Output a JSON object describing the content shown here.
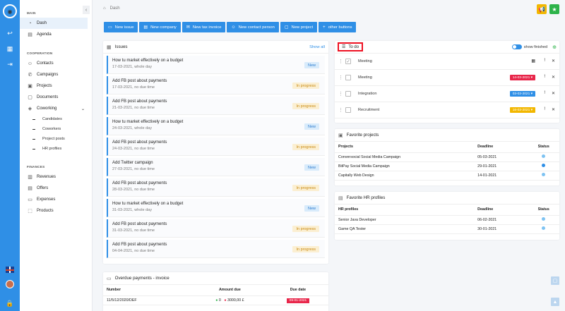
{
  "sidebar": {
    "main_title": "MAIN",
    "main": [
      {
        "label": "Dash",
        "icon": "dashboard-icon"
      },
      {
        "label": "Agenda",
        "icon": "calendar-icon"
      }
    ],
    "coop_title": "COOPERATION",
    "coop": [
      {
        "label": "Contacts",
        "icon": "contacts-icon"
      },
      {
        "label": "Campaigns",
        "icon": "campaigns-icon"
      },
      {
        "label": "Projects",
        "icon": "projects-icon"
      },
      {
        "label": "Documents",
        "icon": "documents-icon"
      },
      {
        "label": "Coworking",
        "icon": "coworking-icon"
      }
    ],
    "coworking_sub": [
      "Candidates",
      "Coworkers",
      "Project posts",
      "HR profiles"
    ],
    "fin_title": "FINANCES",
    "fin": [
      {
        "label": "Revenues",
        "icon": "revenues-icon"
      },
      {
        "label": "Offers",
        "icon": "offers-icon"
      },
      {
        "label": "Expenses",
        "icon": "expenses-icon"
      },
      {
        "label": "Products",
        "icon": "products-icon"
      }
    ]
  },
  "breadcrumb": "Dash",
  "actions": [
    {
      "label": "New issue",
      "icon": "issue-icon"
    },
    {
      "label": "New company",
      "icon": "company-icon"
    },
    {
      "label": "New tax invoice",
      "icon": "invoice-icon"
    },
    {
      "label": "New contact person",
      "icon": "contact-person-icon"
    },
    {
      "label": "New project",
      "icon": "project-icon"
    },
    {
      "label": "other buttons",
      "icon": "plus-icon"
    }
  ],
  "issues": {
    "title": "Issues",
    "show_all": "Show all",
    "items": [
      {
        "title": "How tu market effectively on a budget",
        "date": "17-03-2021, whole day",
        "status": "New"
      },
      {
        "title": "Add FB post about payments",
        "date": "17-03-2021, no due time",
        "status": "In progress"
      },
      {
        "title": "Add FB post about payments",
        "date": "21-03-2021, no due time",
        "status": "In progress"
      },
      {
        "title": "How tu market effectively on a budget",
        "date": "24-03-2021, whole day",
        "status": "New"
      },
      {
        "title": "Add FB post about payments",
        "date": "24-03-2021, no due time",
        "status": "In progress"
      },
      {
        "title": "Add Twitter campaign",
        "date": "27-03-2021, no due time",
        "status": "New"
      },
      {
        "title": "Add FB post about payments",
        "date": "28-03-2021, no due time",
        "status": "In progress"
      },
      {
        "title": "How tu market effectively on a budget",
        "date": "31-03-2021, whole day",
        "status": "New"
      },
      {
        "title": "Add FB post about payments",
        "date": "31-03-2021, no due time",
        "status": "In progress"
      },
      {
        "title": "Add FB post about payments",
        "date": "04-04-2021, no due time",
        "status": "In progress"
      }
    ]
  },
  "overdue": {
    "title": "Overdue payments - invoice",
    "headers": [
      "Number",
      "Amount due",
      "Due date"
    ],
    "row": {
      "number": "11/5/12/2020/DEF",
      "paid": "0",
      "amount": "3000,00 £",
      "due": "09-01-2021"
    }
  },
  "todo": {
    "title": "To do",
    "show_finished": "show finished",
    "items": [
      {
        "label": "Meeting",
        "date": "",
        "color": "",
        "checked": true
      },
      {
        "label": "Meeting",
        "date": "14-03-2021",
        "color": "#e8264a",
        "checked": false
      },
      {
        "label": "Integration",
        "date": "03-03-2021",
        "color": "#2f8fe6",
        "checked": false
      },
      {
        "label": "Recruitment",
        "date": "16-03-2021",
        "color": "#f2b700",
        "checked": false
      }
    ]
  },
  "fav_projects": {
    "title": "Favorite projects",
    "headers": [
      "Projects",
      "Deadline",
      "Status"
    ],
    "rows": [
      {
        "name": "Conversocial Social Media Campaign",
        "deadline": "05-03-2021",
        "status_color": "#7ec3f2"
      },
      {
        "name": "BitPay Social Media Campaign",
        "deadline": "29-01-2021",
        "status_color": "#2f8fe6"
      },
      {
        "name": "Capitally Web Design",
        "deadline": "14-01-2021",
        "status_color": "#7ec3f2"
      }
    ]
  },
  "fav_hr": {
    "title": "Favorite HR profiles",
    "headers": [
      "HR profiles",
      "Deadline",
      "Status"
    ],
    "rows": [
      {
        "name": "Senior Java Developer",
        "deadline": "06-02-2021",
        "status_color": "#7ec3f2"
      },
      {
        "name": "Game QA Tester",
        "deadline": "30-01-2021",
        "status_color": "#7ec3f2"
      }
    ]
  },
  "colors": {
    "accent": "#2f8fe6",
    "warning": "#f2b700",
    "success": "#2db34a",
    "danger": "#e8264a"
  }
}
